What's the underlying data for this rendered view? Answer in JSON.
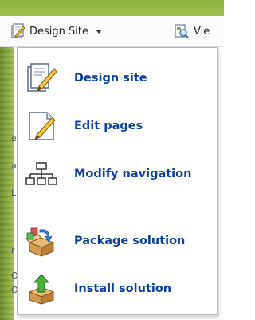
{
  "toolbar": {
    "design_site_label": "Design Site",
    "view_label": "Vie"
  },
  "menu": {
    "items": [
      {
        "label": "Design site",
        "icon": "design-site-icon"
      },
      {
        "label": "Edit pages",
        "icon": "edit-pages-icon"
      },
      {
        "label": "Modify navigation",
        "icon": "sitemap-icon"
      },
      {
        "label": "Package solution",
        "icon": "package-icon"
      },
      {
        "label": "Install solution",
        "icon": "install-icon"
      }
    ]
  },
  "background_fragments": [
    "e",
    "a",
    "L",
    "r",
    "O",
    "O"
  ],
  "colors": {
    "accent_green": "#8db23f",
    "menu_text": "#0c3f9e",
    "menu_border": "#b7b7b7"
  }
}
